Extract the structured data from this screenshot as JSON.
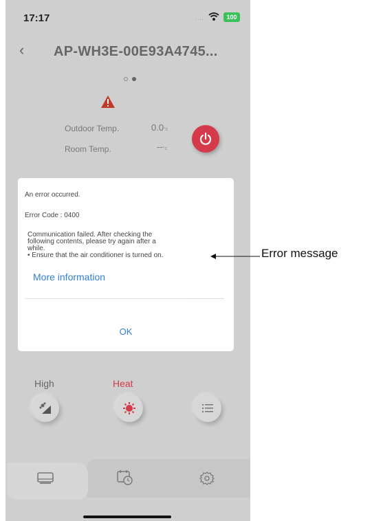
{
  "status_bar": {
    "time": "17:17",
    "signal": "....",
    "battery": "100"
  },
  "header": {
    "back": "‹",
    "title": "AP-WH3E-00E93A4745..."
  },
  "readings": {
    "outdoor_label": "Outdoor Temp.",
    "outdoor_value": "0.0",
    "outdoor_unit": "°c",
    "room_label": "Room Temp.",
    "room_value": "--",
    "room_unit": "°c"
  },
  "controls": {
    "fan_label": "High",
    "mode_label": "Heat",
    "mode_label_color": "#d43a4a"
  },
  "dialog": {
    "title": "An error occurred.",
    "error_code": "Error Code : 0400",
    "message_line1": "Communication failed. After checking the",
    "message_line2": "following contents, please try again after a",
    "message_line3": "while.",
    "message_line4": "• Ensure that the air conditioner is turned on.",
    "link": "More information",
    "ok": "OK"
  },
  "annotation": {
    "label": "Error message"
  },
  "colors": {
    "accent_blue": "#2f7fd4",
    "power_red": "#d43a4a",
    "battery_green": "#3cc05a"
  },
  "icons": [
    "wifi-icon",
    "back-icon",
    "warning-icon",
    "power-icon",
    "fan-speed-icon",
    "heat-mode-icon",
    "menu-list-icon",
    "home-tab-icon",
    "timer-tab-icon",
    "settings-tab-icon"
  ]
}
